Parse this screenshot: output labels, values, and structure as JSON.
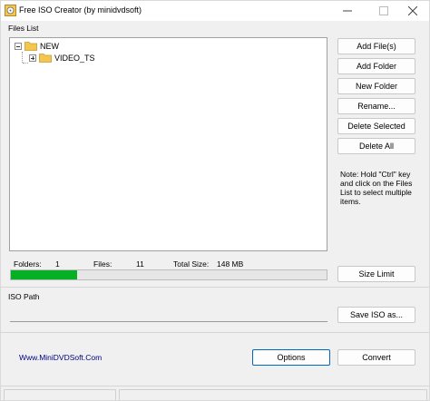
{
  "window": {
    "title": "Free ISO Creator (by minidvdsoft)"
  },
  "files": {
    "label": "Files List",
    "tree": [
      {
        "label": "NEW",
        "expanded": true
      },
      {
        "label": "VIDEO_TS",
        "expanded": false
      }
    ]
  },
  "buttons": {
    "add_files": "Add File(s)",
    "add_folder": "Add Folder",
    "new_folder": "New Folder",
    "rename": "Rename...",
    "delete_selected": "Delete Selected",
    "delete_all": "Delete All",
    "size_limit": "Size Limit",
    "save_iso": "Save ISO as...",
    "options": "Options",
    "convert": "Convert"
  },
  "note": "Note: Hold \"Ctrl\" key and click on the Files List to select multiple items.",
  "stats": {
    "folders_label": "Folders:",
    "folders_value": "1",
    "files_label": "Files:",
    "files_value": "11",
    "size_label": "Total Size:",
    "size_value": "148 MB"
  },
  "progress": {
    "fraction": 0.21
  },
  "iso": {
    "label": "ISO Path",
    "value": ""
  },
  "footer": {
    "site": "Www.MiniDVDSoft.Com"
  },
  "colors": {
    "progress": "#06b025",
    "folder": "#f3c64d",
    "accent": "#0067c0"
  }
}
